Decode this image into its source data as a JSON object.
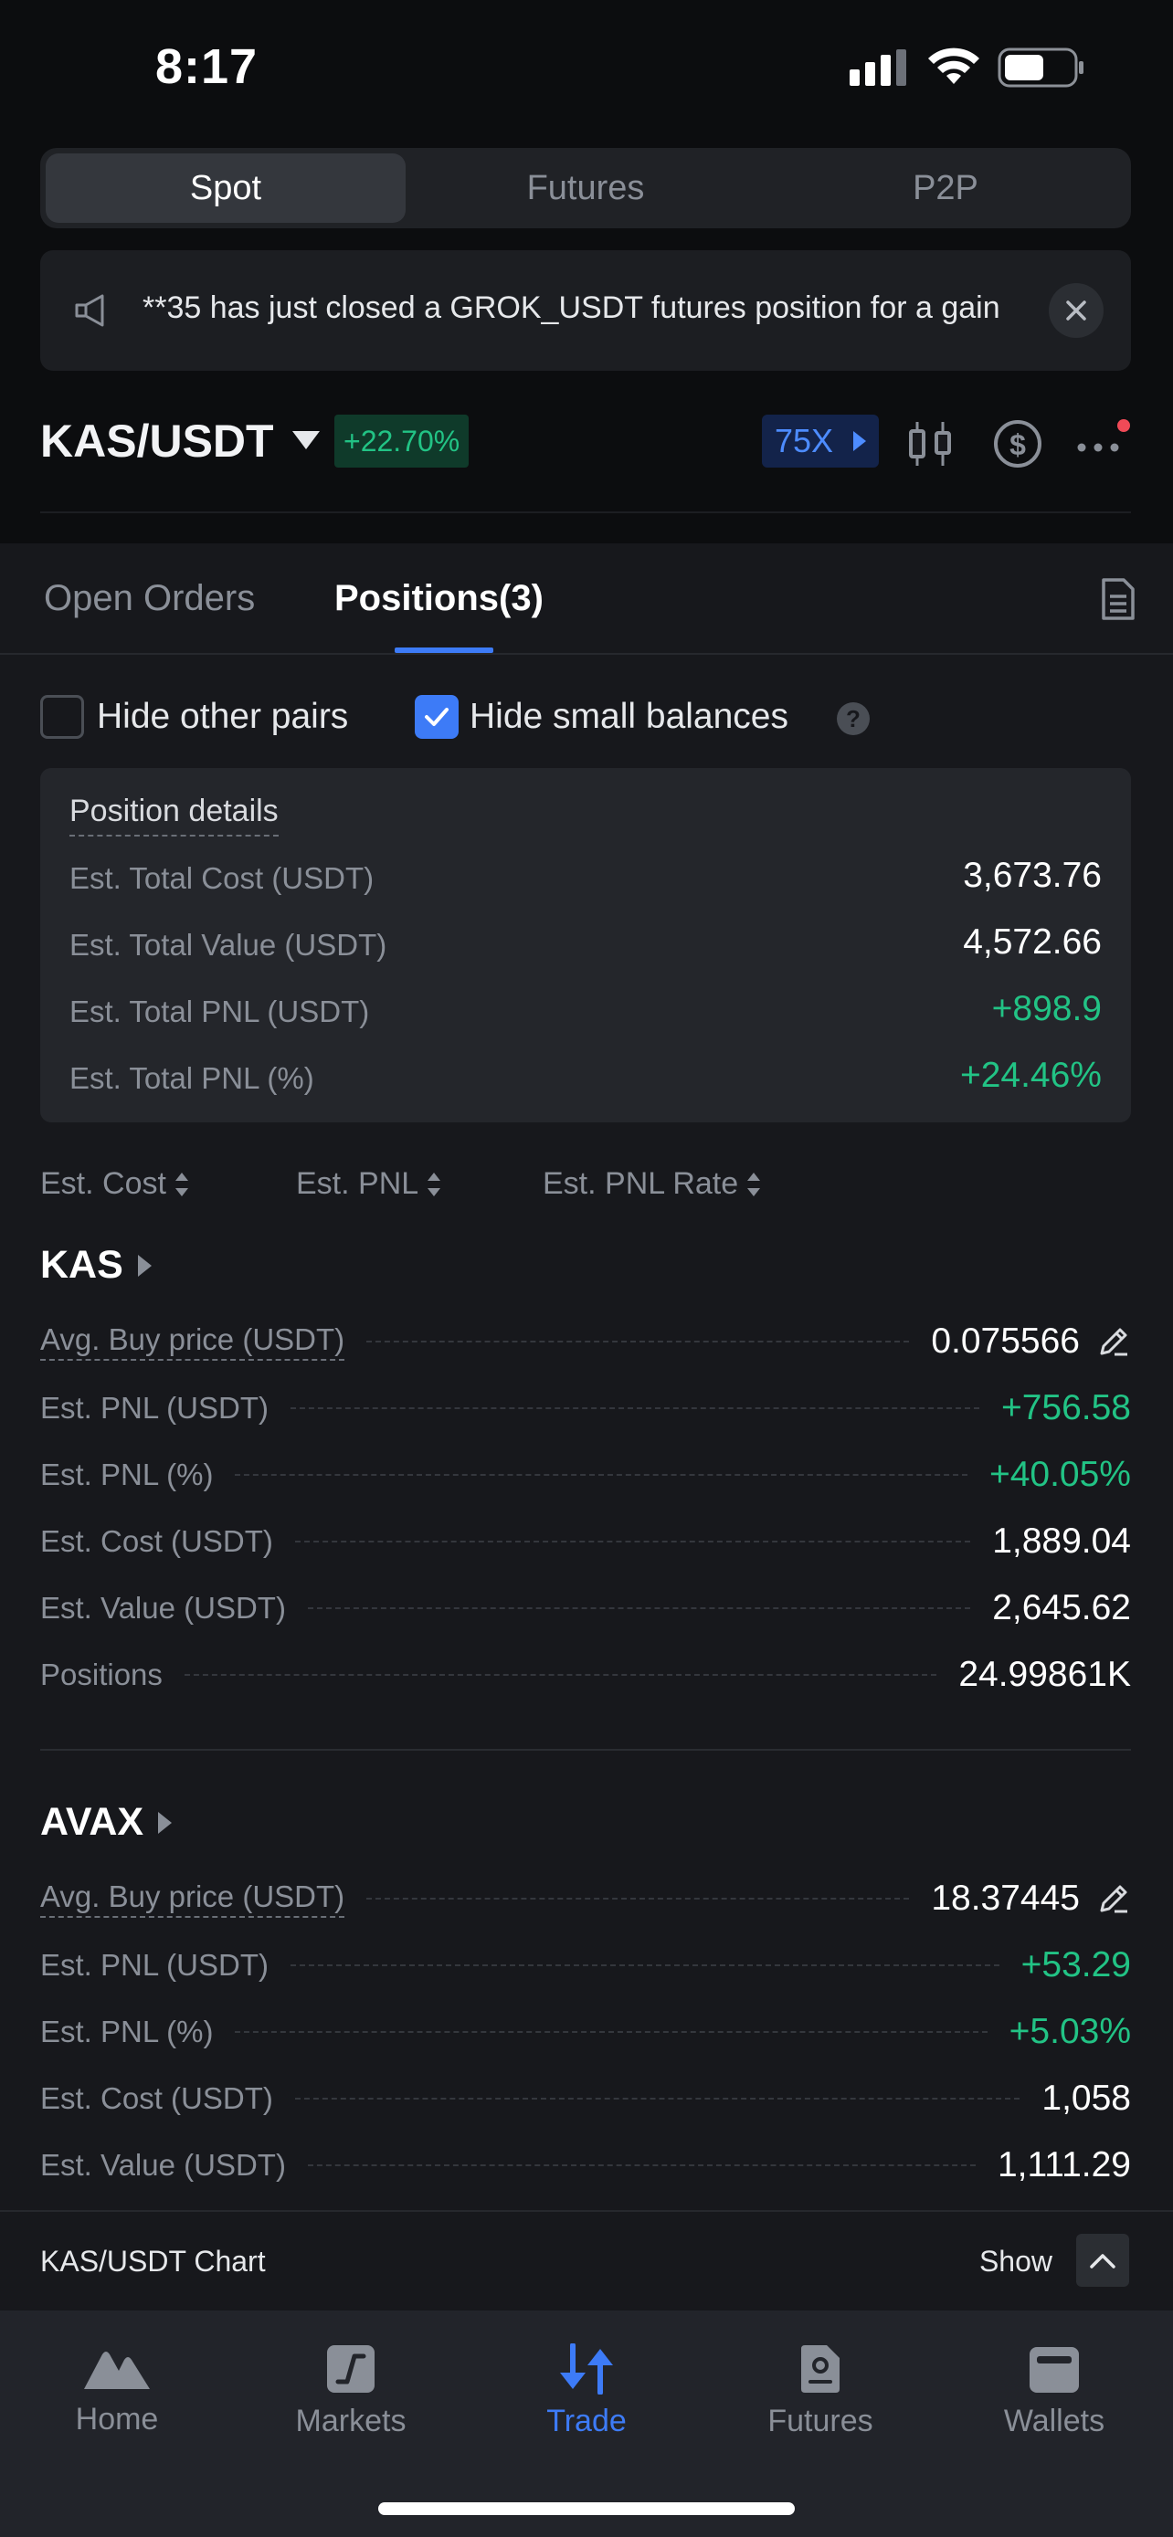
{
  "status_bar": {
    "time": "8:17"
  },
  "segments": [
    {
      "label": "Spot",
      "active": true
    },
    {
      "label": "Futures",
      "active": false
    },
    {
      "label": "P2P",
      "active": false
    }
  ],
  "notice": {
    "text": "**35 has just closed a GROK_USDT futures position for a gain"
  },
  "pair": {
    "name": "KAS/USDT",
    "change": "+22.70%",
    "leverage": "75X"
  },
  "tabs": {
    "open_orders": "Open Orders",
    "positions": "Positions(3)"
  },
  "filters": {
    "hide_other_pairs": "Hide other pairs",
    "hide_small_balances": "Hide small balances",
    "help": "?"
  },
  "details": {
    "title": "Position details",
    "rows": [
      {
        "label": "Est. Total Cost (USDT)",
        "value": "3,673.76"
      },
      {
        "label": "Est. Total Value (USDT)",
        "value": "4,572.66"
      },
      {
        "label": "Est. Total PNL (USDT)",
        "value": "+898.9"
      },
      {
        "label": "Est. Total PNL (%)",
        "value": "+24.46%"
      }
    ]
  },
  "sorts": {
    "cost": "Est. Cost",
    "pnl": "Est. PNL",
    "pnl_rate": "Est. PNL Rate"
  },
  "assets": [
    {
      "name": "KAS",
      "rows": [
        {
          "label": "Avg. Buy price (USDT)",
          "value": "0.075566"
        },
        {
          "label": "Est. PNL (USDT)",
          "value": "+756.58"
        },
        {
          "label": "Est. PNL (%)",
          "value": "+40.05%"
        },
        {
          "label": "Est. Cost (USDT)",
          "value": "1,889.04"
        },
        {
          "label": "Est. Value (USDT)",
          "value": "2,645.62"
        },
        {
          "label": "Positions",
          "value": "24.99861K"
        }
      ]
    },
    {
      "name": "AVAX",
      "rows": [
        {
          "label": "Avg. Buy price (USDT)",
          "value": "18.37445"
        },
        {
          "label": "Est. PNL (USDT)",
          "value": "+53.29"
        },
        {
          "label": "Est. PNL (%)",
          "value": "+5.03%"
        },
        {
          "label": "Est. Cost (USDT)",
          "value": "1,058"
        },
        {
          "label": "Est. Value (USDT)",
          "value": "1,111.29"
        }
      ]
    }
  ],
  "chart_strip": {
    "label": "KAS/USDT Chart",
    "show": "Show"
  },
  "nav": [
    {
      "label": "Home",
      "icon": "home-icon"
    },
    {
      "label": "Markets",
      "icon": "markets-icon"
    },
    {
      "label": "Trade",
      "icon": "trade-icon",
      "active": true
    },
    {
      "label": "Futures",
      "icon": "futures-icon"
    },
    {
      "label": "Wallets",
      "icon": "wallet-icon"
    }
  ],
  "colors": {
    "accent": "#3d7bf7",
    "positive": "#22c385",
    "background": "#17181c"
  }
}
